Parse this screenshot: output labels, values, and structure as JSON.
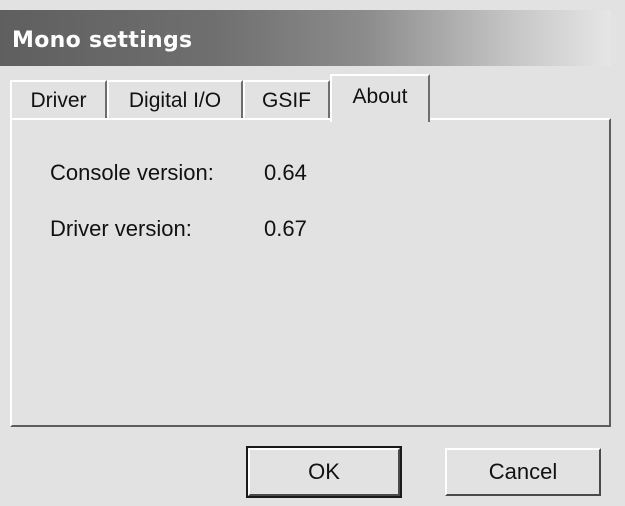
{
  "window": {
    "title": "Mono settings"
  },
  "tabs": [
    {
      "label": "Driver",
      "active": false
    },
    {
      "label": "Digital I/O",
      "active": false
    },
    {
      "label": "GSIF",
      "active": false
    },
    {
      "label": "About",
      "active": true
    }
  ],
  "about": {
    "console_version_label": "Console version:",
    "console_version_value": "0.64",
    "driver_version_label": "Driver version:",
    "driver_version_value": "0.67"
  },
  "buttons": {
    "ok_label": "OK",
    "cancel_label": "Cancel"
  },
  "colors": {
    "window_bg": "#e2e2e2",
    "titlebar_start": "#5f5f5f",
    "titlebar_end": "#e6e6e6",
    "title_text": "#ffffff"
  }
}
